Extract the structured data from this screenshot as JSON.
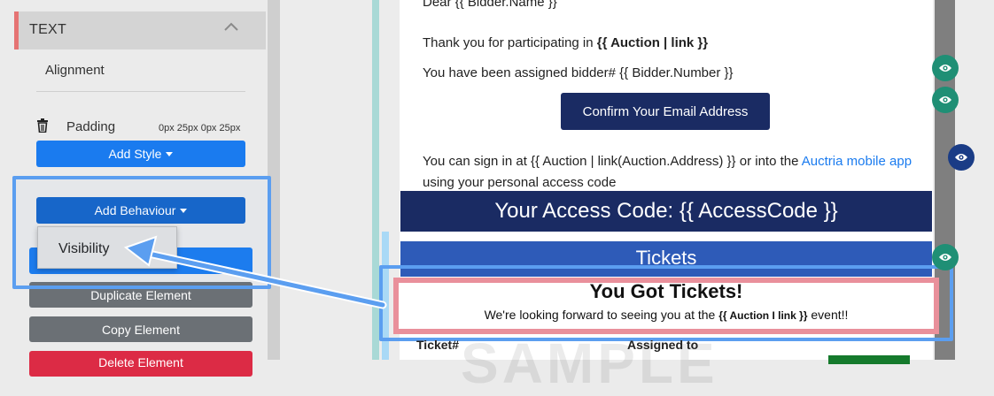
{
  "sidebar": {
    "section_title": "TEXT",
    "alignment_label": "Alignment",
    "padding_label": "Padding",
    "padding_value": "0px 25px 0px 25px",
    "add_style_label": "Add Style",
    "add_behaviour_label": "Add Behaviour",
    "visibility_label": "Visibility",
    "duplicate_label": "Duplicate Element",
    "copy_label": "Copy Element",
    "delete_label": "Delete Element"
  },
  "email": {
    "dear_line": "Dear {{ Bidder.Name }}",
    "thank_prefix": "Thank you for participating in ",
    "thank_bold": "{{ Auction | link }}",
    "assigned_line": "You have been assigned bidder# {{ Bidder.Number }}",
    "confirm_button": "Confirm Your Email Address",
    "signin_prefix": "You can sign in at {{ Auction | link(Auction.Address) }} or into the ",
    "signin_link": "Auctria mobile app",
    "signin_suffix": " using your personal access code",
    "access_code": "Your Access Code: {{ AccessCode }}",
    "tickets_header": "Tickets",
    "got_tickets_title": "You Got Tickets!",
    "got_tickets_prefix": "We're looking forward to seeing you at the ",
    "got_tickets_bold": "{{ Auction I link }}",
    "got_tickets_suffix": " event!!",
    "ticket_col": "Ticket#",
    "assigned_col": "Assigned to",
    "watermark": "SAMPLE"
  },
  "colors": {
    "accent_blue": "#1a7bef",
    "navy": "#1a2b63",
    "highlight_red": "#e9909b",
    "annotation_blue": "#5b9ef0",
    "eye_green": "#1f8f75"
  },
  "icons": [
    "chevron-up-icon",
    "trash-icon",
    "caret-down-icon",
    "eye-icon"
  ]
}
